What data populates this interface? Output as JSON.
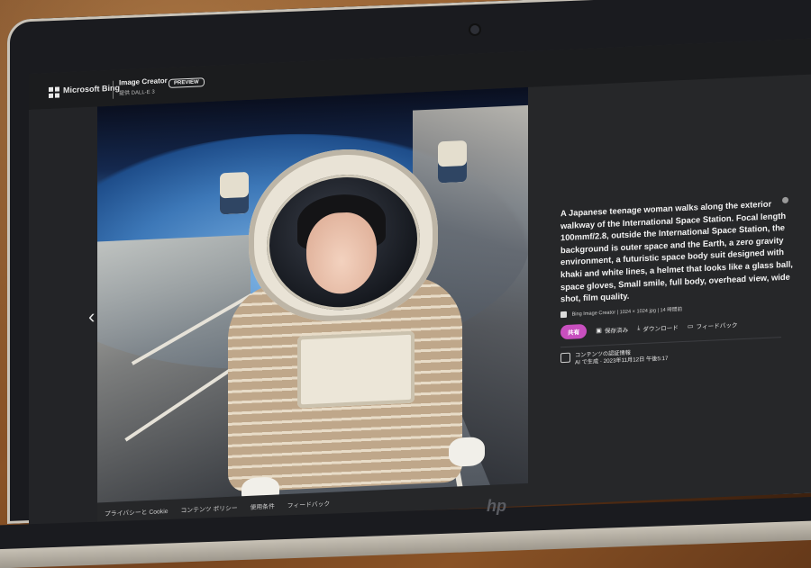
{
  "header": {
    "brand": "Microsoft Bing",
    "app_title": "Image Creator",
    "app_subtitle": "提供 DALL-E 3",
    "preview_badge": "PREVIEW"
  },
  "nav": {
    "prev_icon": "chevron-left-icon",
    "prev_glyph": "‹"
  },
  "image": {
    "corner_mark": "b"
  },
  "details": {
    "prompt": "A Japanese teenage woman walks along the exterior walkway of the International Space Station. Focal length 100mmf/2.8, outside the International Space Station, the background is outer space and the Earth, a zero gravity environment, a futuristic space body suit designed with khaki and white lines, a helmet that looks like a glass ball, space gloves, Small smile, full body, overhead view, wide shot, film quality.",
    "source": "Bing Image Creator",
    "size": "1024 × 1024 jpg",
    "count": "14 時間前",
    "share_label": "共有",
    "save_label": "保存済み",
    "download_label": "ダウンロード",
    "feedback_label": "フィードバック",
    "credentials_title": "コンテンツの認証情報",
    "credentials_text": "AI で生成 · 2023年11月12日 午後5:17"
  },
  "footer": {
    "links": [
      "プライバシーと Cookie",
      "コンテンツ ポリシー",
      "使用条件",
      "フィードバック"
    ]
  },
  "device": {
    "logo": "hp"
  },
  "colors": {
    "share_accent": "#c84fbf",
    "panel_bg": "#262729"
  }
}
